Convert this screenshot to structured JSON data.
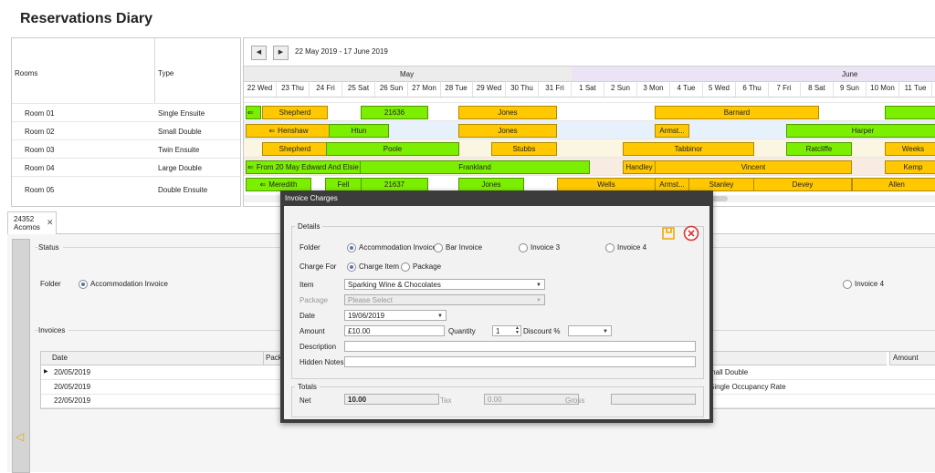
{
  "app": {
    "title": "Reservations Diary"
  },
  "rooms_panel": {
    "col_rooms": "Rooms",
    "col_type": "Type",
    "rows": [
      {
        "room": "Room 01",
        "type": "Single Ensuite"
      },
      {
        "room": "Room 02",
        "type": "Small Double"
      },
      {
        "room": "Room 03",
        "type": "Twin Ensuite"
      },
      {
        "room": "Room 04",
        "type": "Large Double"
      },
      {
        "room": "Room 05",
        "type": "Double Ensuite"
      }
    ]
  },
  "calendar": {
    "prev_icon": "arrow-left-icon",
    "next_icon": "arrow-right-icon",
    "range_label": "22 May 2019 - 17 June 2019",
    "months": [
      "May",
      "June"
    ],
    "days": [
      "22 Wed",
      "23 Thu",
      "24 Fri",
      "25 Sat",
      "26 Sun",
      "27 Mon",
      "28 Tue",
      "29 Wed",
      "30 Thu",
      "31 Fri",
      "1 Sat",
      "2 Sun",
      "3 Mon",
      "4 Tue",
      "5 Wed",
      "6 Thu",
      "7 Fri",
      "8 Sat",
      "9 Sun",
      "10 Mon",
      "11 Tue"
    ],
    "row_tints": [
      "#ffffff",
      "#e6f1fb",
      "#fbf6e2",
      "#f7ebe2",
      "#ffffff"
    ],
    "bookings": [
      [
        {
          "label": "",
          "color": "green",
          "arrow": true
        },
        {
          "label": "Shepherd",
          "color": "yellow"
        },
        {
          "label": "21636",
          "color": "green"
        },
        {
          "label": "Jones",
          "color": "yellow"
        },
        {
          "label": "Barnard",
          "color": "yellow"
        },
        {
          "label": "",
          "color": "green"
        }
      ],
      [
        {
          "label": "Henshaw",
          "color": "yellow",
          "arrow": true
        },
        {
          "label": "Htun",
          "color": "green"
        },
        {
          "label": "Jones",
          "color": "yellow"
        },
        {
          "label": "Armst...",
          "color": "yellow"
        },
        {
          "label": "Harper",
          "color": "green"
        }
      ],
      [
        {
          "label": "Shepherd",
          "color": "yellow"
        },
        {
          "label": "Poole",
          "color": "green"
        },
        {
          "label": "Stubbs",
          "color": "yellow"
        },
        {
          "label": "Tabbinor",
          "color": "yellow"
        },
        {
          "label": "Ratcliffe",
          "color": "green"
        },
        {
          "label": "Weeks",
          "color": "yellow"
        }
      ],
      [
        {
          "label": "From 20 May Edward And Elsie",
          "color": "green",
          "arrow": true
        },
        {
          "label": "Frankland",
          "color": "green"
        },
        {
          "label": "Handley",
          "color": "yellow"
        },
        {
          "label": "Vincent",
          "color": "yellow"
        },
        {
          "label": "Kemp",
          "color": "yellow"
        }
      ],
      [
        {
          "label": "Meredith",
          "color": "green",
          "arrow": true
        },
        {
          "label": "Fell",
          "color": "green"
        },
        {
          "label": "21637",
          "color": "green"
        },
        {
          "label": "Jones",
          "color": "green"
        },
        {
          "label": "Wells",
          "color": "yellow"
        },
        {
          "label": "Armst...",
          "color": "yellow"
        },
        {
          "label": "Stanley",
          "color": "yellow"
        },
        {
          "label": "Devey",
          "color": "yellow"
        },
        {
          "label": "Allen",
          "color": "yellow"
        }
      ]
    ]
  },
  "doc_tab": {
    "line1": "24352",
    "line2": "Acomos",
    "close": "✕"
  },
  "status": {
    "legend": "Status",
    "folder_label": "Folder",
    "accommodation_invoice": "Accommodation Invoice",
    "invoice4": "Invoice 4"
  },
  "invoices": {
    "legend": "Invoices",
    "columns": [
      "Date",
      "Packa",
      "",
      "Amount"
    ],
    "rows": [
      {
        "date": "20/05/2019",
        "desc": "mall Double"
      },
      {
        "date": "20/05/2019",
        "desc": "Single Occupancy Rate"
      },
      {
        "date": "22/05/2019",
        "desc": ""
      }
    ]
  },
  "modal": {
    "title": "Invoice Charges",
    "details_legend": "Details",
    "folder_label": "Folder",
    "folder_options": [
      "Accommodation Invoice",
      "Bar Invoice",
      "Invoice 3",
      "Invoice 4"
    ],
    "charge_for_label": "Charge For",
    "charge_for_options": [
      "Charge Item",
      "Package"
    ],
    "item_label": "Item",
    "item_value": "Sparking Wine & Chocolates",
    "package_label": "Package",
    "package_placeholder": "Please Select",
    "date_label": "Date",
    "date_value": "19/06/2019",
    "amount_label": "Amount",
    "amount_value": "£10.00",
    "quantity_label": "Quantity",
    "quantity_value": "1",
    "discount_label": "Discount %",
    "description_label": "Description",
    "hidden_notes_label": "Hidden Notes",
    "totals_legend": "Totals",
    "net_label": "Net",
    "net_value": "10.00",
    "tax_label": "Tax",
    "tax_value": "0.00",
    "gross_label": "Gross",
    "save_icon": "save-icon",
    "close_icon": "close-circle-icon",
    "accent": "#f0a800",
    "danger": "#e03030"
  }
}
